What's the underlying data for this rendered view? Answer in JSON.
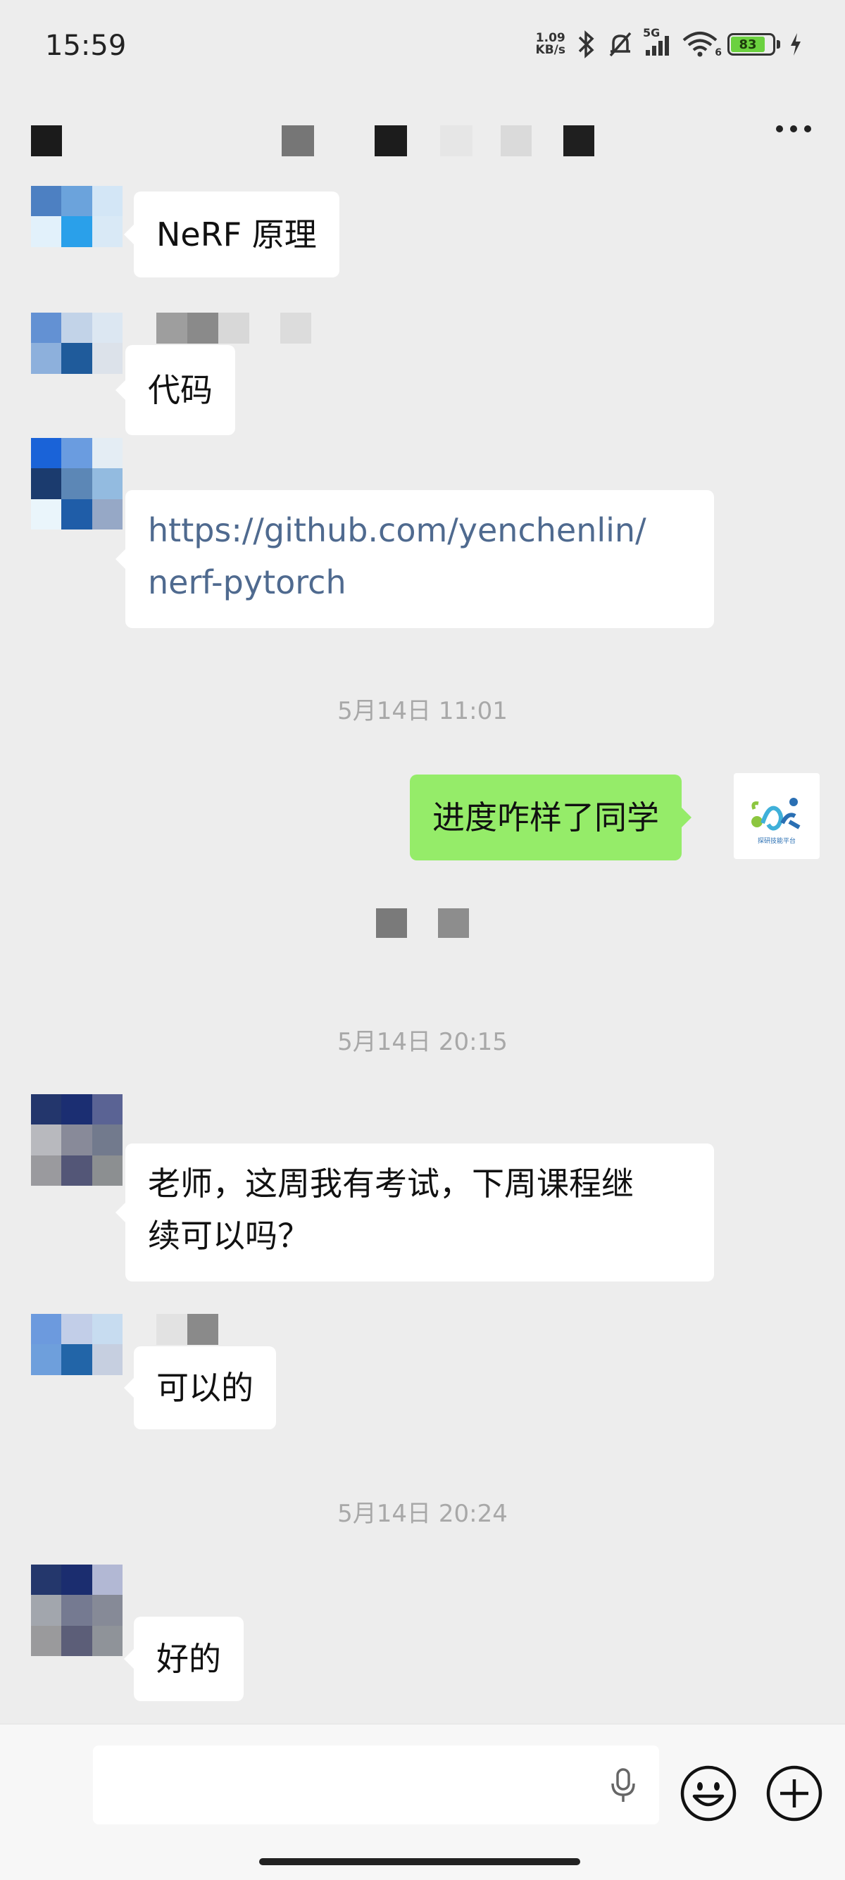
{
  "status_bar": {
    "time": "15:59",
    "net_speed_value": "1.09",
    "net_speed_unit": "KB/s",
    "signal_label": "5G",
    "wifi_label": "6",
    "battery_level": "83"
  },
  "messages": [
    {
      "side": "left",
      "text": "NeRF 原理"
    },
    {
      "side": "left",
      "text": "代码"
    },
    {
      "side": "left",
      "text_line1": "https://github.com/yenchenlin/",
      "text_line2": "nerf-pytorch",
      "type": "link"
    },
    {
      "type": "timestamp",
      "text": "5月14日 11:01"
    },
    {
      "side": "right",
      "text": "进度咋样了同学"
    },
    {
      "type": "timestamp",
      "text": "5月14日 20:15"
    },
    {
      "side": "left",
      "text_line1": "老师，这周我有考试，下周课程继",
      "text_line2": "续可以吗？"
    },
    {
      "side": "left",
      "text": "可以的"
    },
    {
      "type": "timestamp",
      "text": "5月14日 20:24"
    },
    {
      "side": "left",
      "text": "好的"
    }
  ],
  "logo": {
    "caption": "探研技能平台"
  },
  "colors": {
    "self_bubble": "#95ec69",
    "link": "#4f6a8f",
    "background": "#ededed"
  }
}
